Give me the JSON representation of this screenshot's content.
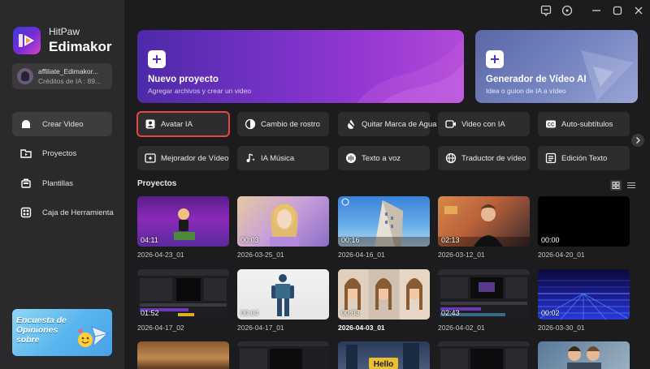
{
  "app": {
    "brand_line1": "HitPaw",
    "brand_line2": "Edimakor"
  },
  "user": {
    "name": "affiliate_Edimakor...",
    "credits": "Créditos de IA : 89..."
  },
  "nav": [
    {
      "label": "Crear Video",
      "icon": "video-icon",
      "active": true
    },
    {
      "label": "Proyectos",
      "icon": "folder-icon",
      "active": false
    },
    {
      "label": "Plantillas",
      "icon": "template-icon",
      "active": false
    },
    {
      "label": "Caja de Herramienta",
      "icon": "toolbox-icon",
      "active": false
    }
  ],
  "promo": {
    "text": "Encuesta de Opiniones sobre"
  },
  "titlebar_icons": [
    "feedback-icon",
    "help-icon",
    "minimize-icon",
    "maximize-icon",
    "close-icon"
  ],
  "hero": {
    "new_project": {
      "title": "Nuevo proyecto",
      "subtitle": "Agregar archivos y crear un video"
    },
    "ai_generator": {
      "title": "Generador de Vídeo AI",
      "subtitle": "Idea o guion de IA a vídeo"
    }
  },
  "tools": [
    {
      "label": "Avatar IA",
      "icon": "avatar-icon",
      "selected": true
    },
    {
      "label": "Cambio de rostro",
      "icon": "face-swap-icon",
      "selected": false
    },
    {
      "label": "Quitar Marca de Agua",
      "icon": "watermark-remove-icon",
      "selected": false
    },
    {
      "label": "Video con IA",
      "icon": "ai-video-icon",
      "selected": false
    },
    {
      "label": "Auto-subtítulos",
      "icon": "cc-icon",
      "selected": false
    },
    {
      "label": "Mejorador de Vídeo",
      "icon": "enhancer-icon",
      "selected": false
    },
    {
      "label": "IA Música",
      "icon": "music-icon",
      "selected": false
    },
    {
      "label": "Texto a voz",
      "icon": "tts-icon",
      "selected": false
    },
    {
      "label": "Traductor de vídeo",
      "icon": "translate-icon",
      "selected": false
    },
    {
      "label": "Edición Texto",
      "icon": "text-edit-icon",
      "selected": false
    }
  ],
  "projects_section": {
    "title": "Proyectos"
  },
  "projects": [
    {
      "name": "2026-04-23_01",
      "duration": "04:11"
    },
    {
      "name": "2026-03-25_01",
      "duration": "00:03"
    },
    {
      "name": "2026-04-16_01",
      "duration": "00:16"
    },
    {
      "name": "2026-03-12_01",
      "duration": "02:13"
    },
    {
      "name": "2026-04-20_01",
      "duration": "00:00"
    },
    {
      "name": "2026-04-17_02",
      "duration": "01:52"
    },
    {
      "name": "2026-04-17_01",
      "duration": "00:04"
    },
    {
      "name": "2026-04-03_01",
      "duration": "00:03"
    },
    {
      "name": "2026-04-02_01",
      "duration": "02:43"
    },
    {
      "name": "2026-03-30_01",
      "duration": "00:02"
    },
    {
      "name": "",
      "duration": ""
    },
    {
      "name": "",
      "duration": ""
    },
    {
      "name": "",
      "duration": ""
    },
    {
      "name": "",
      "duration": ""
    },
    {
      "name": "",
      "duration": ""
    }
  ],
  "colors": {
    "accent_red": "#e8473d",
    "sidebar_bg": "#2a2a2c",
    "main_bg": "#1c1c1e"
  }
}
